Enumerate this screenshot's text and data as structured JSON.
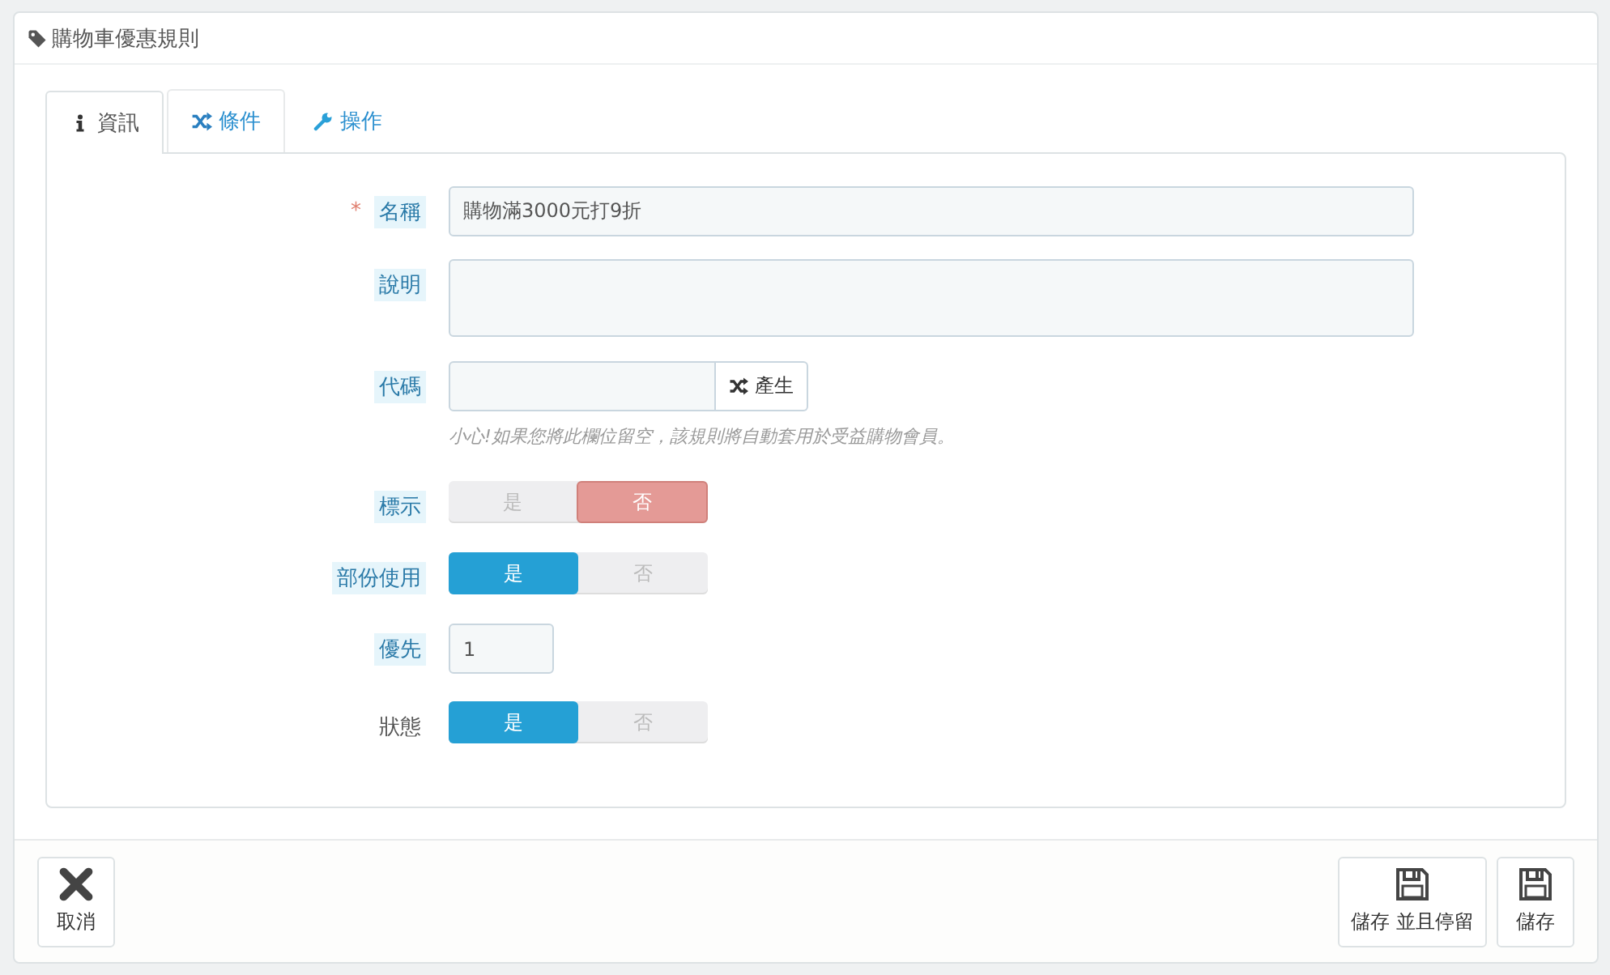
{
  "panel": {
    "title": "購物車優惠規則"
  },
  "tabs": [
    {
      "label": "資訊",
      "selected": true
    },
    {
      "label": "條件",
      "selected": false
    },
    {
      "label": "操作",
      "selected": false
    }
  ],
  "fields": [
    {
      "kind": "text",
      "marker": "*",
      "label": "名稱",
      "help": true,
      "value": "購物滿3000元打9折"
    },
    {
      "kind": "textarea",
      "label": "說明",
      "help": true
    },
    {
      "kind": "code",
      "label": "代碼",
      "help": true,
      "button": "產生",
      "hint": "小心!如果您將此欄位留空，該規則將自動套用於受益購物會員。"
    },
    {
      "kind": "switch",
      "label": "標示",
      "help": true,
      "options": [
        {
          "label": "是",
          "selected": false
        },
        {
          "label": "否",
          "selected": true
        }
      ]
    },
    {
      "kind": "switch",
      "label": "部份使用",
      "help": true,
      "options": [
        {
          "label": "是",
          "selected": true
        },
        {
          "label": "否",
          "selected": false
        }
      ]
    },
    {
      "kind": "number",
      "label": "優先",
      "help": true,
      "value": "1"
    },
    {
      "kind": "switch",
      "label": "狀態",
      "help": false,
      "options": [
        {
          "label": "是",
          "selected": true
        },
        {
          "label": "否",
          "selected": false
        }
      ]
    }
  ],
  "footer": {
    "left": [
      {
        "label": "取消"
      }
    ],
    "right": [
      {
        "label": "儲存 並且停留"
      },
      {
        "label": "儲存"
      }
    ]
  }
}
